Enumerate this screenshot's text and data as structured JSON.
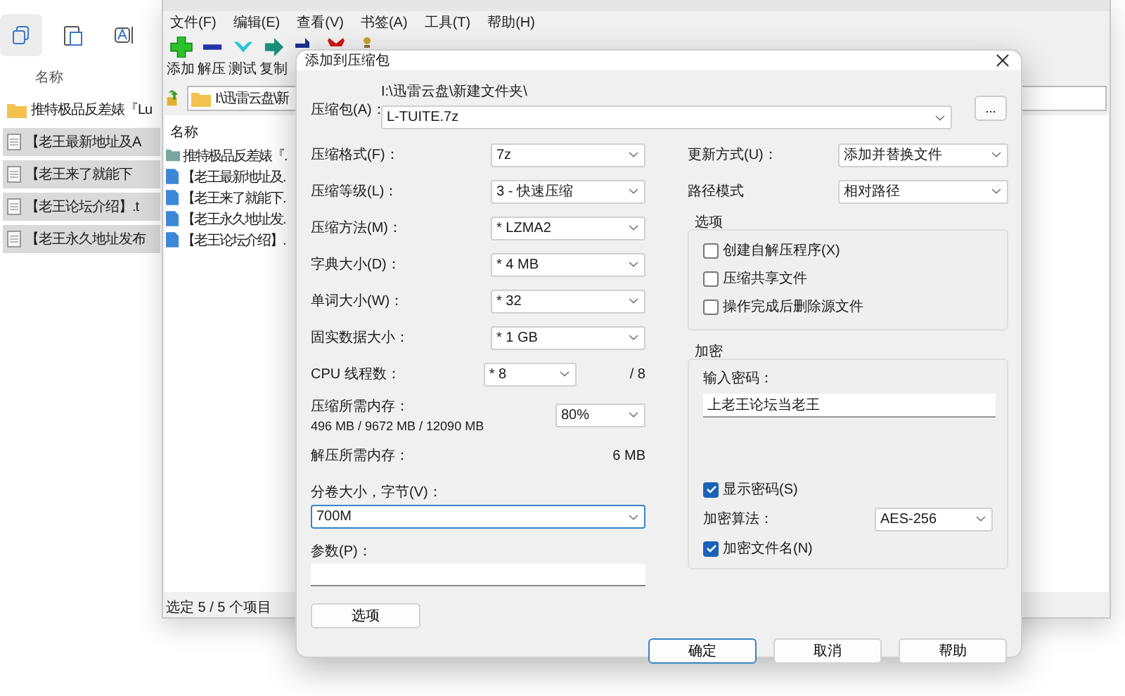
{
  "explorer": {
    "column_header": "名称",
    "items": [
      {
        "name": "推特极品反差婊『Lu",
        "kind": "folder",
        "selected": false
      },
      {
        "name": "【老王最新地址及A",
        "kind": "file",
        "selected": true
      },
      {
        "name": "【老王来了就能下",
        "kind": "file",
        "selected": true
      },
      {
        "name": "【老王论坛介绍】.t",
        "kind": "file",
        "selected": true
      },
      {
        "name": "【老王永久地址发布",
        "kind": "file",
        "selected": true
      }
    ]
  },
  "archiver": {
    "menu": [
      "文件(F)",
      "编辑(E)",
      "查看(V)",
      "书签(A)",
      "工具(T)",
      "帮助(H)"
    ],
    "toolbar": [
      {
        "kind": "add",
        "label": "添加"
      },
      {
        "kind": "extract",
        "label": "解压"
      },
      {
        "kind": "test",
        "label": "测试"
      },
      {
        "kind": "copy",
        "label": "复制"
      },
      {
        "kind": "move"
      },
      {
        "kind": "delete"
      },
      {
        "kind": "info"
      }
    ],
    "address": "I:\\迅雷云盘\\新",
    "column_header": "名称",
    "items": [
      {
        "name": "推特极品反差婊『.",
        "kind": "folder"
      },
      {
        "name": "【老王最新地址及.",
        "kind": "file"
      },
      {
        "name": "【老王来了就能下.",
        "kind": "file"
      },
      {
        "name": "【老王永久地址发.",
        "kind": "file"
      },
      {
        "name": "【老王论坛介绍】.",
        "kind": "file"
      }
    ],
    "status": "选定 5 / 5 个项目"
  },
  "dialog": {
    "title": "添加到压缩包",
    "archive_label": "压缩包(A)：",
    "archive_path": "I:\\迅雷云盘\\新建文件夹\\",
    "archive_name": "L-TUITE.7z",
    "browse_button": "...",
    "left_rows": [
      {
        "kind": "select",
        "label": "压缩格式(F)：",
        "value": "7z"
      },
      {
        "kind": "select",
        "label": "压缩等级(L)：",
        "value": "3 - 快速压缩"
      },
      {
        "kind": "select",
        "label": "压缩方法(M)：",
        "value": "* LZMA2"
      },
      {
        "kind": "select",
        "label": "字典大小(D)：",
        "value": "* 4 MB"
      },
      {
        "kind": "select",
        "label": "单词大小(W)：",
        "value": "* 32"
      },
      {
        "kind": "select",
        "label": "固实数据大小：",
        "value": "* 1 GB"
      },
      {
        "kind": "threads",
        "label": "CPU 线程数：",
        "value": "* 8",
        "max": "/ 8"
      },
      {
        "kind": "memory",
        "label": "压缩所需内存：",
        "detail": "496 MB / 9672 MB / 12090 MB",
        "value": "80%"
      },
      {
        "kind": "info",
        "label": "解压所需内存：",
        "value": "6 MB"
      }
    ],
    "volume": {
      "label": "分卷大小，字节(V)：",
      "value": "700M",
      "focused": true
    },
    "params": {
      "label": "参数(P)："
    },
    "options_button": "选项",
    "right_rows": [
      {
        "label": "更新方式(U)：",
        "value": "添加并替换文件"
      },
      {
        "label": "路径模式",
        "value": "相对路径"
      }
    ],
    "options_group": {
      "title": "选项",
      "items": [
        {
          "label": "创建自解压程序(X)",
          "checked": false
        },
        {
          "label": "压缩共享文件",
          "checked": false
        },
        {
          "label": "操作完成后删除源文件",
          "checked": false
        }
      ]
    },
    "encryption": {
      "title": "加密",
      "password_label": "输入密码：",
      "password": "上老王论坛当老王",
      "show_password": {
        "label": "显示密码(S)",
        "checked": true
      },
      "method_label": "加密算法：",
      "method": "AES-256",
      "encrypt_names": {
        "label": "加密文件名(N)",
        "checked": true
      }
    },
    "buttons": [
      {
        "label": "确定",
        "default": true
      },
      {
        "label": "取消",
        "default": false
      },
      {
        "label": "帮助",
        "default": false
      }
    ]
  }
}
